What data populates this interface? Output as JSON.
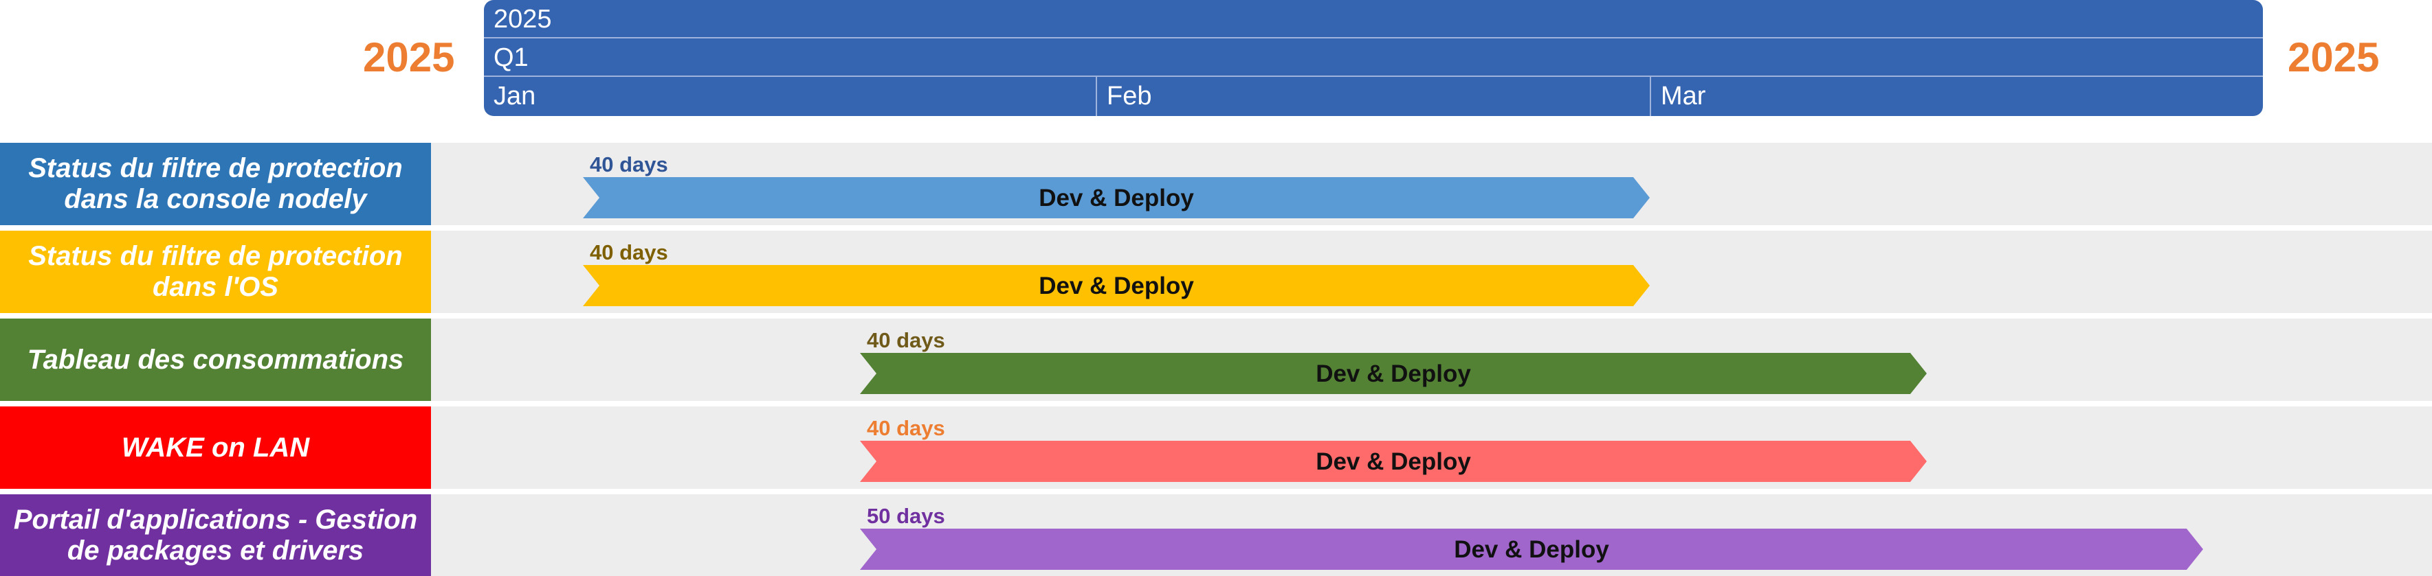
{
  "timeline": {
    "year_left": "2025",
    "year_right": "2025",
    "scale": {
      "year": "2025",
      "quarter": "Q1",
      "months": [
        "Jan",
        "Feb",
        "Mar"
      ]
    }
  },
  "tasks": [
    {
      "label_line1": "Status du filtre de protection",
      "label_line2": "dans la console nodely",
      "label_color": "#2E75B6",
      "duration": "40 days",
      "duration_color": "#2F5597",
      "bar_label": "Dev & Deploy",
      "bar_color": "#5B9BD5"
    },
    {
      "label_line1": "Status du filtre de protection",
      "label_line2": "dans l'OS",
      "label_color": "#FFC000",
      "duration": "40 days",
      "duration_color": "#7F6000",
      "bar_label": "Dev & Deploy",
      "bar_color": "#FFC000"
    },
    {
      "label_line1": "Tableau des consommations",
      "label_line2": "",
      "label_color": "#548235",
      "duration": "40 days",
      "duration_color": "#6F5A1A",
      "bar_label": "Dev & Deploy",
      "bar_color": "#548235"
    },
    {
      "label_line1": "WAKE on LAN",
      "label_line2": "",
      "label_color": "#FF0000",
      "duration": "40 days",
      "duration_color": "#ED7D31",
      "bar_label": "Dev & Deploy",
      "bar_color": "#FF6B6B"
    },
    {
      "label_line1": "Portail d'applications - Gestion",
      "label_line2": "de packages et drivers",
      "label_color": "#7030A0",
      "duration": "50 days",
      "duration_color": "#7030A0",
      "bar_label": "Dev & Deploy",
      "bar_color": "#A066CC"
    }
  ]
}
